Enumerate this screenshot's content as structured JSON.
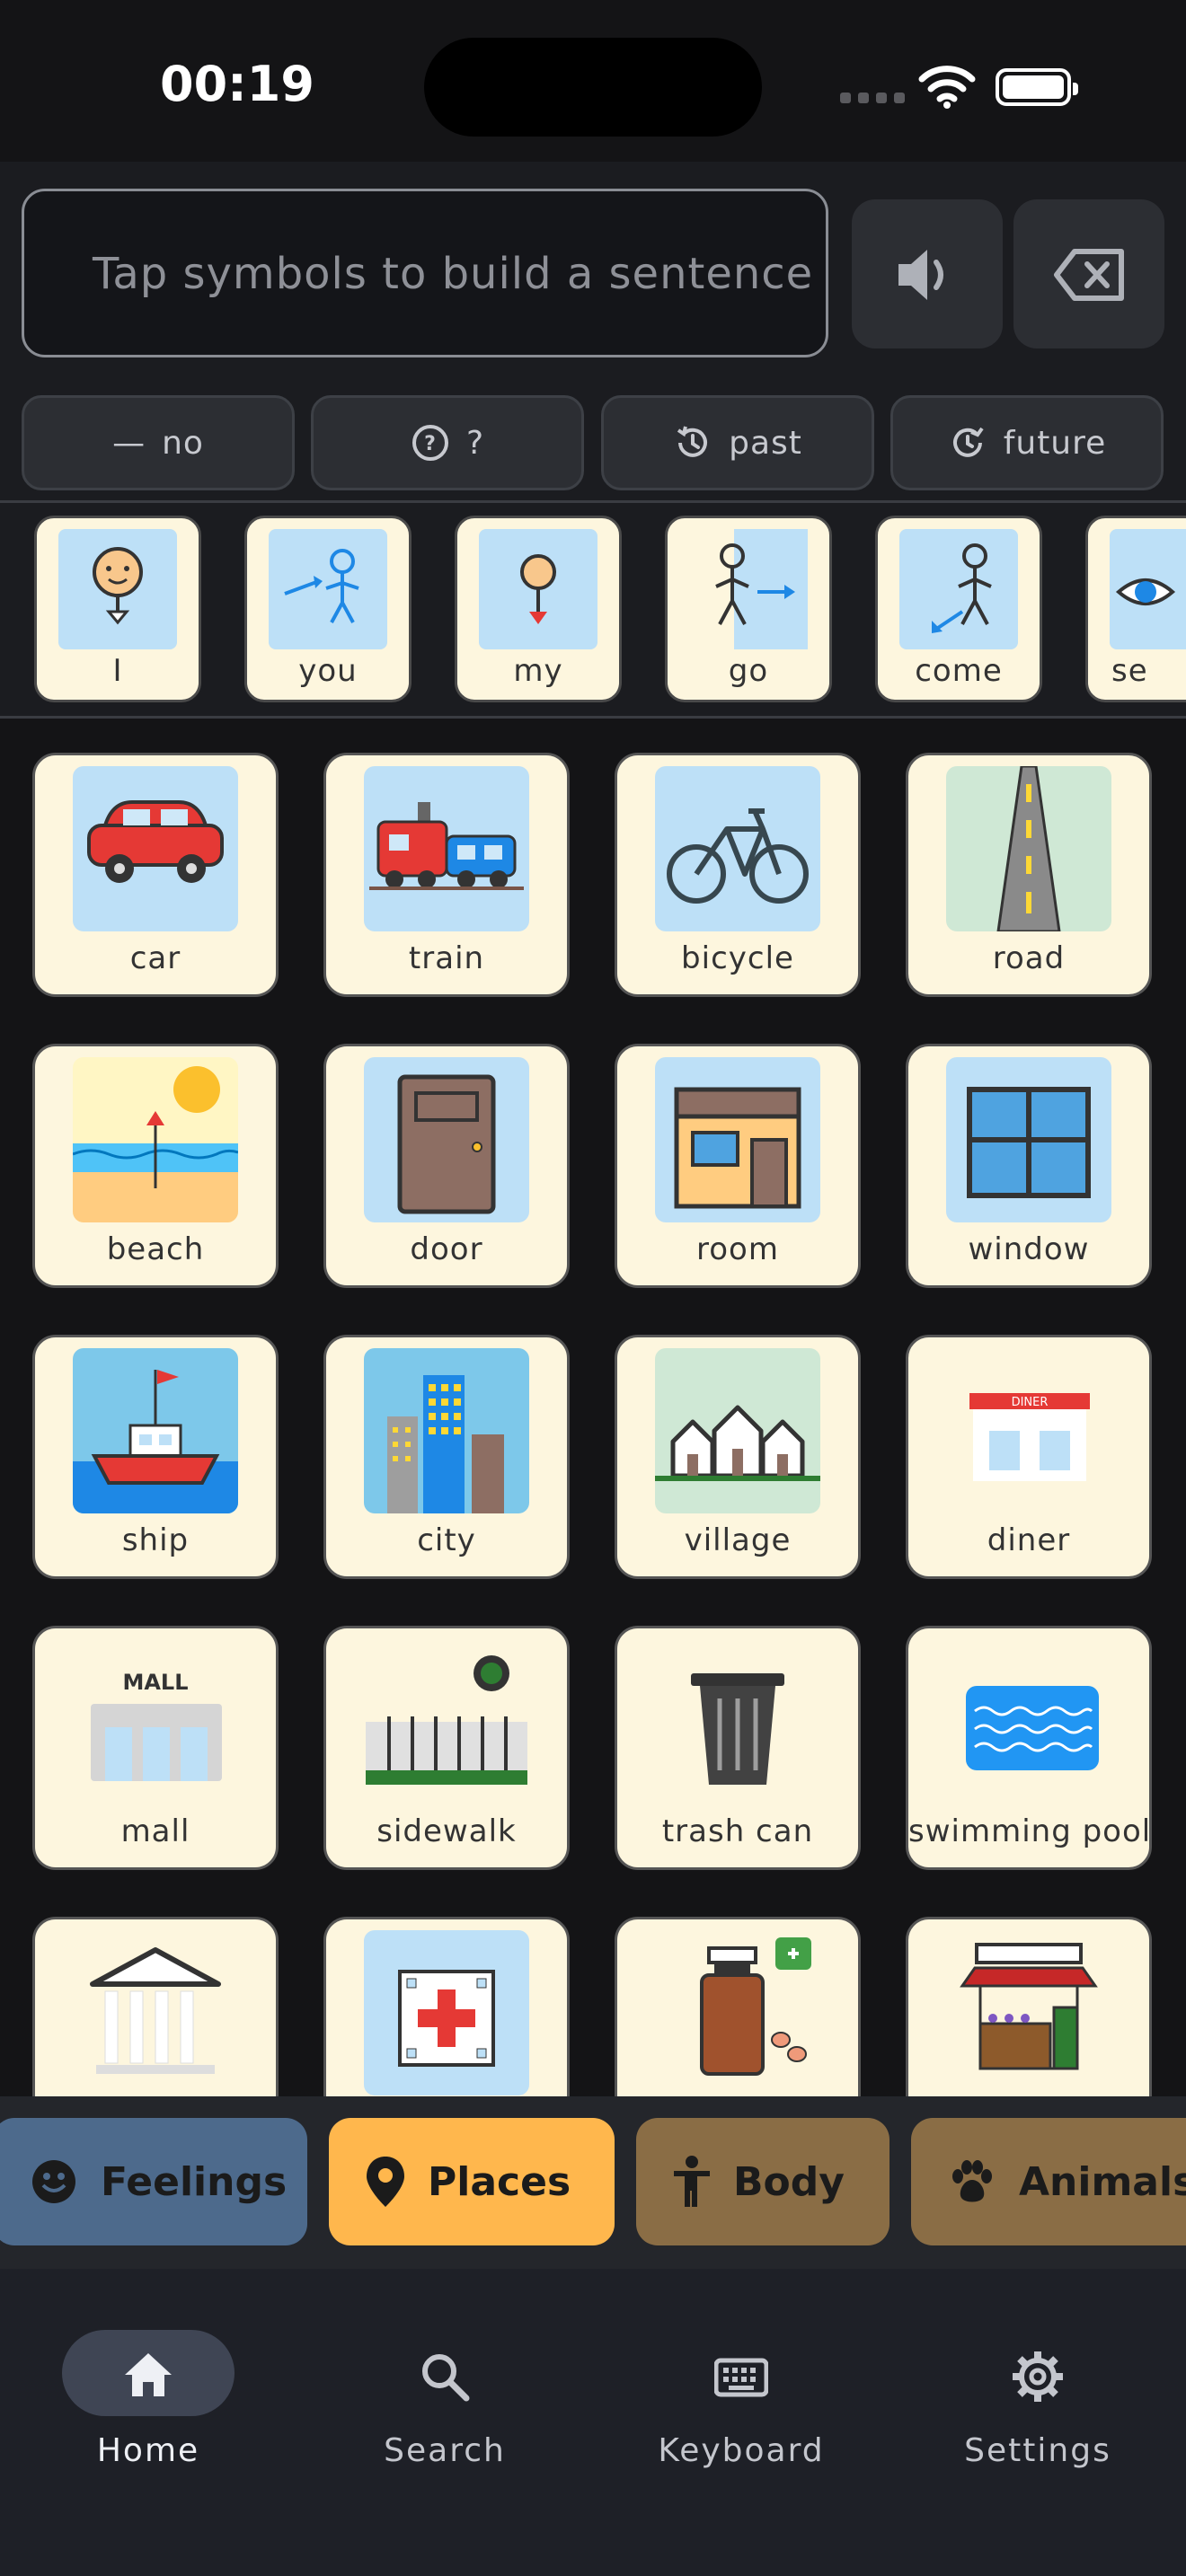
{
  "status": {
    "time": "00:19"
  },
  "sentence": {
    "placeholder": "Tap symbols to build a sentence",
    "speak_icon": "speaker-icon",
    "delete_icon": "backspace-icon"
  },
  "modifiers": [
    {
      "label": "no",
      "icon": "minus-icon"
    },
    {
      "label": "?",
      "icon": "question-icon"
    },
    {
      "label": "past",
      "icon": "history-icon"
    },
    {
      "label": "future",
      "icon": "refresh-icon"
    }
  ],
  "core_words": [
    "I",
    "you",
    "my",
    "go",
    "come",
    "se"
  ],
  "symbols": [
    [
      "car",
      "train",
      "bicycle",
      "road"
    ],
    [
      "beach",
      "door",
      "room",
      "window"
    ],
    [
      "ship",
      "city",
      "village",
      "diner"
    ],
    [
      "mall",
      "sidewalk",
      "trash can",
      "swimming pool"
    ],
    [
      "",
      "",
      "",
      ""
    ]
  ],
  "symbol_text": {
    "diner_sign": "DINER",
    "mall_sign": "MALL"
  },
  "categories": [
    {
      "label": "Feelings",
      "icon": "smiley-icon",
      "color": "#4d6a8c"
    },
    {
      "label": "Places",
      "icon": "location-pin-icon",
      "color": "#ffb74d",
      "active": true
    },
    {
      "label": "Body",
      "icon": "body-icon",
      "color": "#8a6d45"
    },
    {
      "label": "Animals",
      "icon": "paw-icon",
      "color": "#8a6d45"
    }
  ],
  "nav": [
    {
      "label": "Home",
      "icon": "home-icon",
      "active": true
    },
    {
      "label": "Search",
      "icon": "search-icon"
    },
    {
      "label": "Keyboard",
      "icon": "keyboard-icon"
    },
    {
      "label": "Settings",
      "icon": "gear-icon"
    }
  ]
}
